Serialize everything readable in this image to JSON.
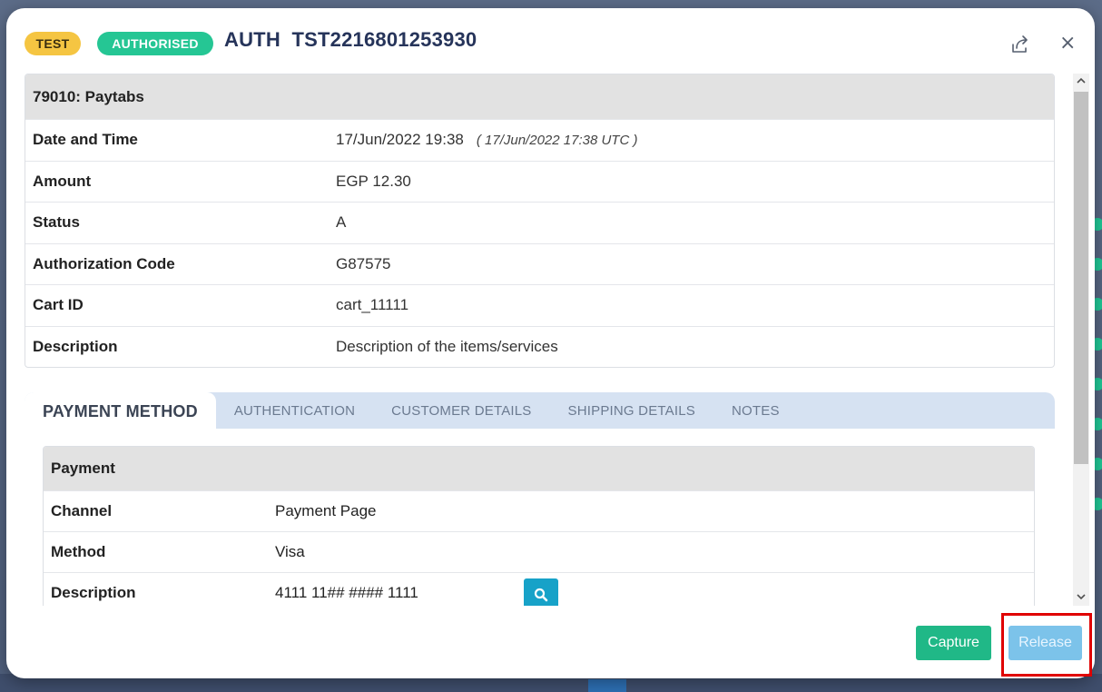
{
  "header": {
    "badge_test": "TEST",
    "badge_status": "AUTHORISED",
    "title": "AUTH  TST2216801253930",
    "close_glyph": "×"
  },
  "info": {
    "heading": "79010: Paytabs",
    "rows": [
      {
        "label": "Date and Time",
        "value": "17/Jun/2022 19:38",
        "note": "( 17/Jun/2022 17:38 UTC )"
      },
      {
        "label": "Amount",
        "value": "EGP 12.30"
      },
      {
        "label": "Status",
        "value": "A"
      },
      {
        "label": "Authorization Code",
        "value": "G87575"
      },
      {
        "label": "Cart ID",
        "value": "cart_11111"
      },
      {
        "label": "Description",
        "value": "Description of the items/services"
      }
    ]
  },
  "tabs": [
    {
      "label": "PAYMENT METHOD",
      "active": true
    },
    {
      "label": "AUTHENTICATION"
    },
    {
      "label": "CUSTOMER DETAILS"
    },
    {
      "label": "SHIPPING DETAILS"
    },
    {
      "label": "NOTES"
    }
  ],
  "payment": {
    "heading": "Payment",
    "rows": [
      {
        "label": "Channel",
        "value": "Payment Page"
      },
      {
        "label": "Method",
        "value": "Visa"
      },
      {
        "label": "Description",
        "value": "4111 11## #### 1111"
      }
    ]
  },
  "footer": {
    "capture_label": "Capture",
    "release_label": "Release"
  },
  "colors": {
    "badge_test": "#f5c542",
    "badge_status": "#25c694",
    "capture": "#20b887",
    "release": "#7cc3ea",
    "highlight": "#e00000"
  },
  "icons": [
    "share-icon",
    "close-icon",
    "search-icon",
    "chevron-up-icon",
    "chevron-down-icon"
  ]
}
